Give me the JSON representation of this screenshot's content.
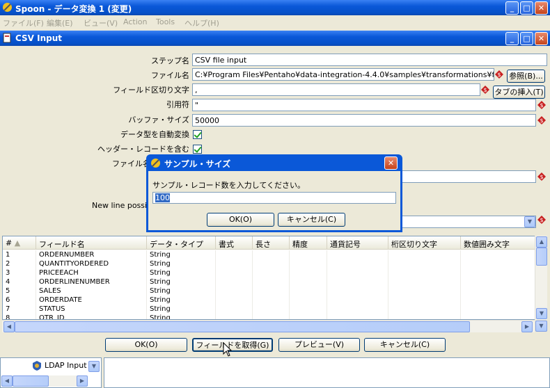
{
  "app": {
    "title": "Spoon - データ変換 1 (変更)",
    "menu": [
      "ファイル(F)",
      "編集(E)",
      "ビュー(V)",
      "Action",
      "Tools",
      "ヘルプ(H)"
    ]
  },
  "step_window": {
    "title": "CSV Input"
  },
  "form": {
    "step_name_label": "ステップ名",
    "step_name_value": "CSV file input",
    "filename_label": "ファイル名",
    "filename_value": "C:¥Program Files¥Pentaho¥data-integration-4.4.0¥samples¥transformations¥files¥sa",
    "browse_button": "参照(B)...",
    "delimiter_label": "フィールド区切り文字",
    "delimiter_value": ",",
    "insert_tab_button": "タブの挿入(T)",
    "enclosure_label": "引用符",
    "enclosure_value": "\"",
    "buffer_label": "バッファ・サイズ",
    "buffer_value": "50000",
    "lazy_label": "データ型を自動変換",
    "header_label": "ヘッダー・レコードを含む",
    "filename_field_label": "ファイル名",
    "newline_label": "New line possib"
  },
  "table": {
    "headers": [
      "#",
      "フィールド名",
      "データ・タイプ",
      "書式",
      "長さ",
      "精度",
      "通貨記号",
      "桁区切り文字",
      "数値囲み文字"
    ],
    "rows": [
      [
        "1",
        "ORDERNUMBER",
        "String"
      ],
      [
        "2",
        "QUANTITYORDERED",
        "String"
      ],
      [
        "3",
        "PRICEEACH",
        "String"
      ],
      [
        "4",
        "ORDERLINENUMBER",
        "String"
      ],
      [
        "5",
        "SALES",
        "String"
      ],
      [
        "6",
        "ORDERDATE",
        "String"
      ],
      [
        "7",
        "STATUS",
        "String"
      ],
      [
        "8",
        "QTR_ID",
        "String"
      ]
    ]
  },
  "buttons": {
    "ok": "OK(O)",
    "get_fields": "フィールドを取得(G)",
    "preview": "プレビュー(V)",
    "cancel": "キャンセル(C)"
  },
  "tree": {
    "item": "LDAP Input"
  },
  "dialog": {
    "title": "サンプル・サイズ",
    "prompt": "サンプル・レコード数を入力してください。",
    "value": "100",
    "ok": "OK(O)",
    "cancel": "キャンセル(C)"
  }
}
